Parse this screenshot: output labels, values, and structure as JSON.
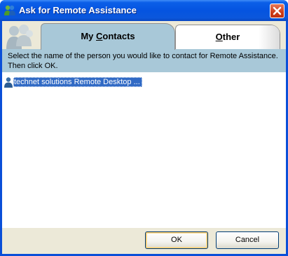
{
  "window": {
    "title": "Ask for Remote Assistance"
  },
  "tabs": {
    "contacts_prefix": "My ",
    "contacts_mnemonic": "C",
    "contacts_rest": "ontacts",
    "other_mnemonic": "O",
    "other_rest": "ther"
  },
  "instructions": "Select the name of the person you would like to contact for Remote Assistance. Then click OK.",
  "contacts": [
    {
      "label": "technet solutions Remote Desktop ...",
      "selected": true
    }
  ],
  "buttons": {
    "ok": "OK",
    "cancel": "Cancel"
  },
  "colors": {
    "titlebar": "#0554e0",
    "panel": "#a8c8d8",
    "selection": "#316ac5",
    "close": "#cc3c18"
  }
}
